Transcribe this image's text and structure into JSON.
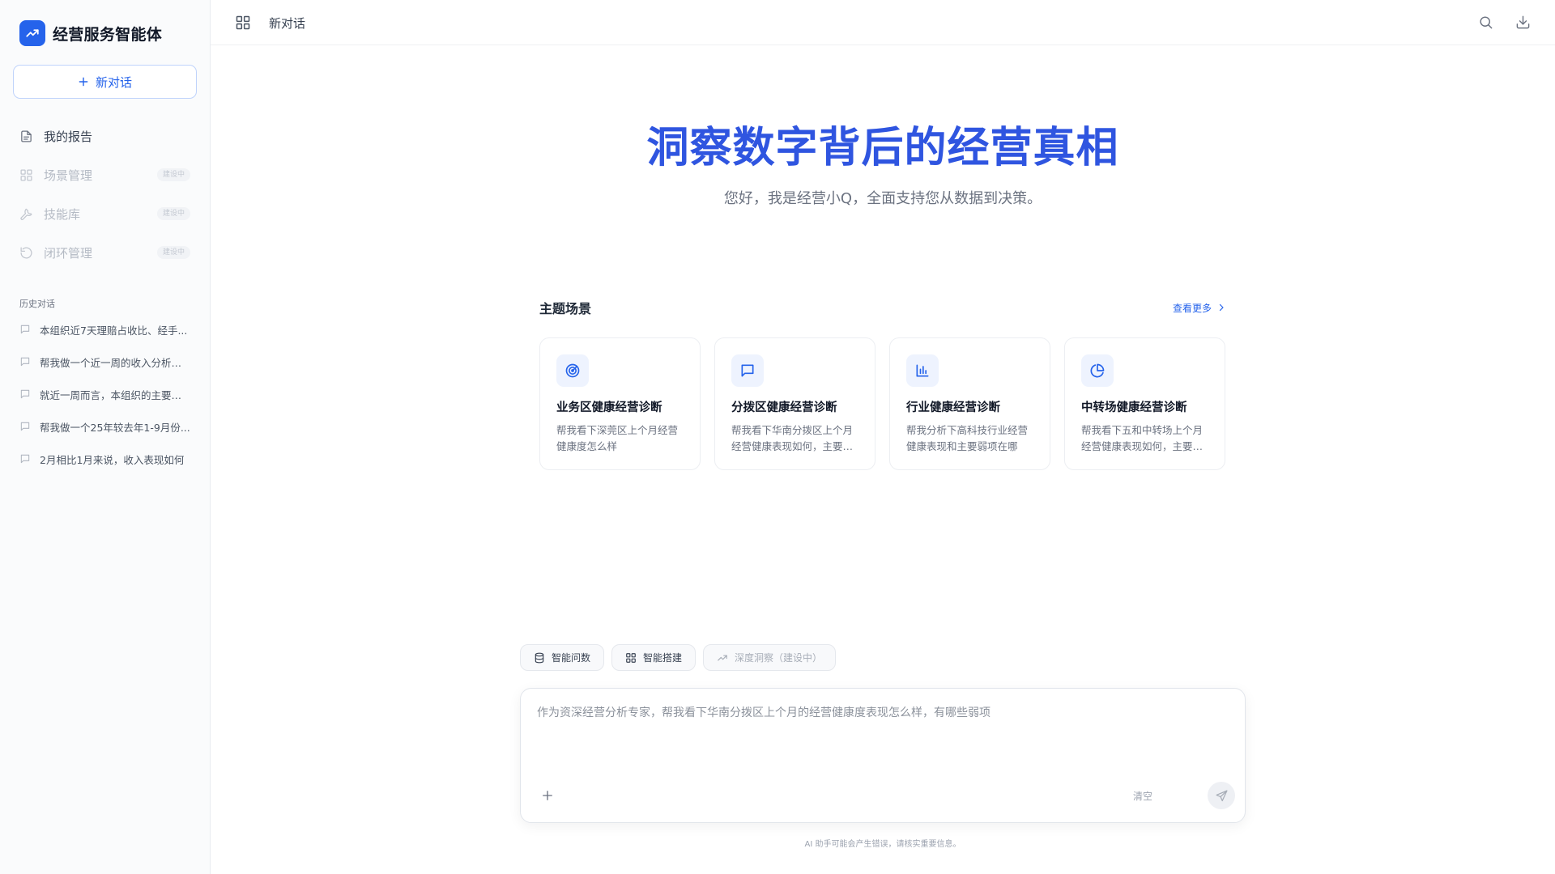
{
  "brand": {
    "name": "经营服务智能体",
    "logo_icon": "trending-up-icon",
    "accent": "#2563eb"
  },
  "sidebar": {
    "new_chat_label": "新对话",
    "nav": [
      {
        "label": "我的报告",
        "icon": "document-icon",
        "badge": ""
      },
      {
        "label": "场景管理",
        "icon": "grid-icon",
        "badge": "建设中"
      },
      {
        "label": "技能库",
        "icon": "wrench-icon",
        "badge": "建设中"
      },
      {
        "label": "闭环管理",
        "icon": "refresh-icon",
        "badge": "建设中"
      }
    ],
    "history_title": "历史对话",
    "history": [
      "本组织近7天理赔占收比、经手...",
      "帮我做一个近一周的收入分析（...",
      "就近一周而言，本组织的主要质...",
      "帮我做一个25年较去年1-9月份...",
      "2月相比1月来说，收入表现如何"
    ]
  },
  "topbar": {
    "title": "新对话"
  },
  "hero": {
    "title": "洞察数字背后的经营真相",
    "subtitle": "您好，我是经营小Q，全面支持您从数据到决策。",
    "title_color": "#2f55e0"
  },
  "scenes": {
    "title": "主题场景",
    "more_label": "查看更多",
    "cards": [
      {
        "title": "业务区健康经营诊断",
        "desc": "帮我看下深莞区上个月经营健康度怎么样",
        "icon": "radar-target-icon"
      },
      {
        "title": "分拨区健康经营诊断",
        "desc": "帮我看下华南分拨区上个月经营健康表现如何，主要弱项在哪",
        "icon": "message-square-icon"
      },
      {
        "title": "行业健康经营诊断",
        "desc": "帮我分析下高科技行业经营健康表现和主要弱项在哪",
        "icon": "bar-chart-icon"
      },
      {
        "title": "中转场健康经营诊断",
        "desc": "帮我看下五和中转场上个月经营健康表现如何，主要弱项在哪",
        "icon": "pie-chart-icon"
      }
    ]
  },
  "modes": [
    {
      "label": "智能问数",
      "icon": "database-icon"
    },
    {
      "label": "智能搭建",
      "icon": "grid-icon"
    },
    {
      "label": "深度洞察（建设中）",
      "icon": "trending-up-icon"
    }
  ],
  "composer": {
    "placeholder": "作为资深经营分析专家，帮我看下华南分拨区上个月的经营健康度表现怎么样，有哪些弱项",
    "clear_label": "清空"
  },
  "disclaimer": "AI 助手可能会产生错误，请核实重要信息。"
}
